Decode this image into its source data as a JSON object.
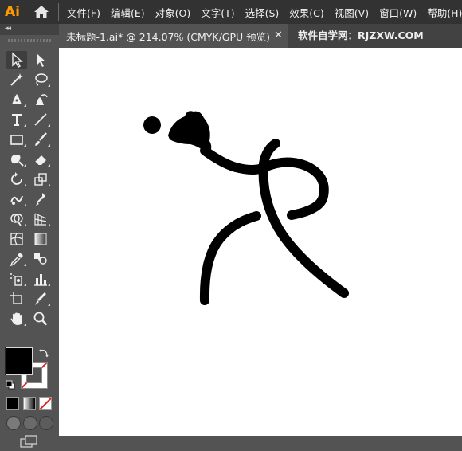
{
  "app": {
    "logo_text": "Ai",
    "accent": "#ff9a00"
  },
  "menu": {
    "items": [
      "文件(F)",
      "编辑(E)",
      "对象(O)",
      "文字(T)",
      "选择(S)",
      "效果(C)",
      "视图(V)",
      "窗口(W)",
      "帮助(H)"
    ]
  },
  "tab": {
    "title": "未标题-1.ai* @ 214.07% (CMYK/GPU 预览)",
    "close_glyph": "✕",
    "watermark": "软件自学网：RJZXW.COM"
  },
  "toolbar": {
    "collapse_glyph": "◂◂",
    "tools": [
      "selection-tool",
      "direct-selection-tool",
      "magic-wand-tool",
      "lasso-tool",
      "pen-tool",
      "curvature-tool",
      "type-tool",
      "line-segment-tool",
      "rectangle-tool",
      "paintbrush-tool",
      "shaper-tool",
      "eraser-tool",
      "rotate-tool",
      "scale-tool",
      "puppet-warp-tool",
      "free-transform-tool",
      "shape-builder-tool",
      "perspective-grid-tool",
      "mesh-tool",
      "gradient-tool",
      "eyedropper-tool",
      "blend-tool",
      "symbol-sprayer-tool",
      "column-graph-tool",
      "artboard-tool",
      "slice-tool",
      "hand-tool",
      "zoom-tool"
    ],
    "fill_color": "#000000",
    "stroke_color": "none"
  },
  "canvas": {
    "background": "#ffffff",
    "artwork_color": "#000000"
  }
}
